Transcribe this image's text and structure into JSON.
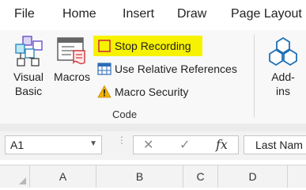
{
  "tabs": [
    {
      "label": "File"
    },
    {
      "label": "Home"
    },
    {
      "label": "Insert"
    },
    {
      "label": "Draw"
    },
    {
      "label": "Page Layout"
    }
  ],
  "ribbon": {
    "visual_basic": {
      "line1": "Visual",
      "line2": "Basic",
      "icon": "visual-basic-icon"
    },
    "macros": {
      "label": "Macros",
      "icon": "macros-icon"
    },
    "stop_recording": {
      "label": "Stop Recording",
      "icon": "stop-recording-icon"
    },
    "relative_refs": {
      "label": "Use Relative References",
      "icon": "grid-icon"
    },
    "macro_security": {
      "label": "Macro Security",
      "icon": "warning-icon"
    },
    "group_label": "Code",
    "addins": {
      "line1": "Add-",
      "line2": "ins",
      "icon": "addins-icon"
    },
    "highlight_color": "#f7f200"
  },
  "formula_bar": {
    "name_box": "A1",
    "cancel_glyph": "✕",
    "enter_glyph": "✓",
    "fx": "fx",
    "content": "Last Nam"
  },
  "columns": [
    "A",
    "B",
    "C",
    "D"
  ]
}
